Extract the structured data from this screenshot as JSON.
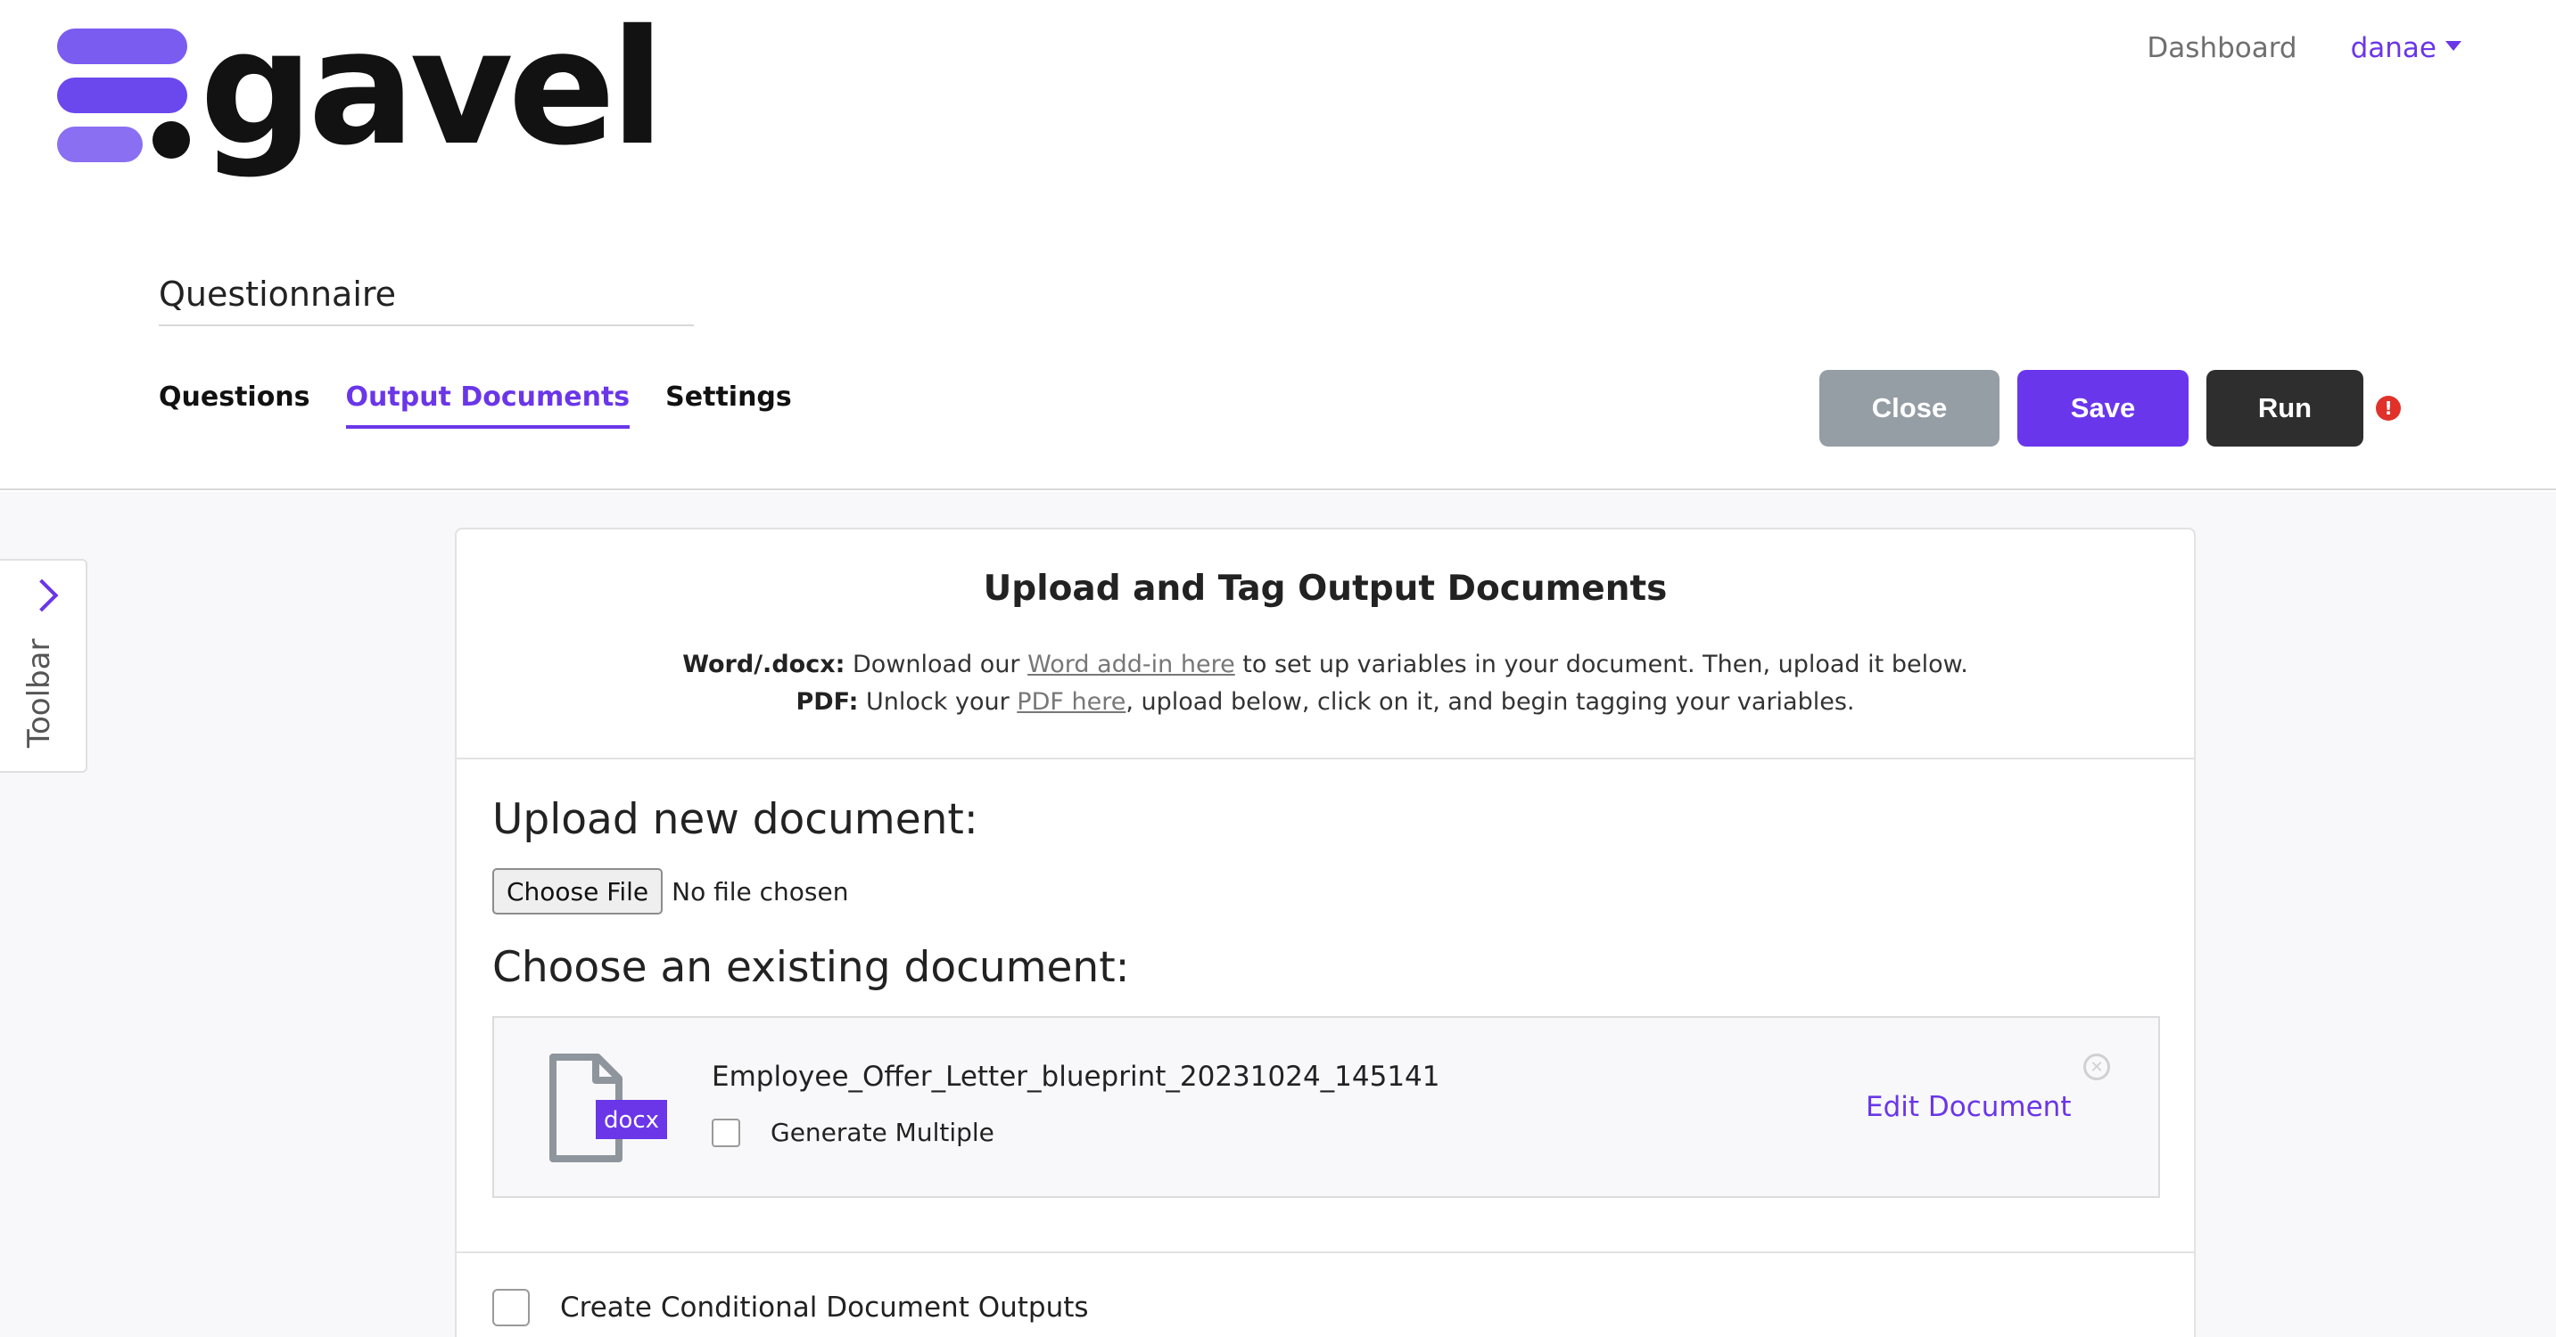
{
  "brand": {
    "logo_text": "gavel",
    "accent": "#6a36e8"
  },
  "top_nav": {
    "dashboard": "Dashboard",
    "user": "danae"
  },
  "questionnaire_title": "Questionnaire",
  "tabs": [
    {
      "label": "Questions",
      "active": false
    },
    {
      "label": "Output Documents",
      "active": true
    },
    {
      "label": "Settings",
      "active": false
    }
  ],
  "actions": {
    "close": "Close",
    "save": "Save",
    "run": "Run",
    "warning_icon": "!"
  },
  "toolbar": {
    "label": "Toolbar"
  },
  "card": {
    "title": "Upload and Tag Output Documents",
    "word_label": "Word/.docx:",
    "word_pre": " Download our ",
    "word_link": "Word add-in here",
    "word_post": " to set up variables in your document. Then, upload it below.",
    "pdf_label": "PDF:",
    "pdf_pre": " Unlock your ",
    "pdf_link": "PDF here",
    "pdf_post": ", upload below, click on it, and begin tagging your variables."
  },
  "upload": {
    "heading": "Upload new document:",
    "choose_file": "Choose File",
    "no_file": "No file chosen"
  },
  "existing": {
    "heading": "Choose an existing document:",
    "document": {
      "file_type": "docx",
      "name": "Employee_Offer_Letter_blueprint_20231024_145141",
      "generate_multiple_label": "Generate Multiple",
      "edit_label": "Edit Document",
      "remove_icon": "✕"
    }
  },
  "conditional": {
    "label": "Create Conditional Document Outputs"
  }
}
